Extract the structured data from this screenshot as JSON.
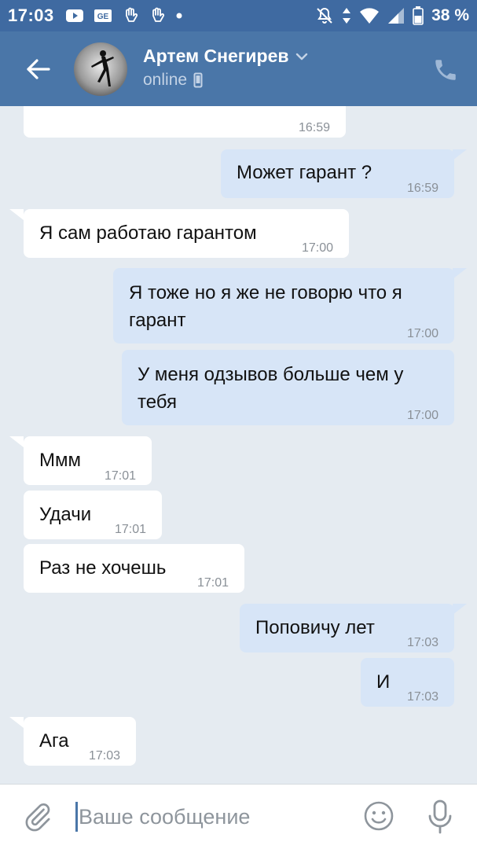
{
  "status_bar": {
    "time": "17:03",
    "battery": "38 %"
  },
  "header": {
    "contact_name": "Артем Снегирев",
    "status": "online"
  },
  "messages": [
    {
      "direction": "in",
      "text": "",
      "time": "16:59"
    },
    {
      "direction": "out",
      "text": "Может гарант ?",
      "time": "16:59"
    },
    {
      "direction": "in",
      "text": "Я сам работаю гарантом",
      "time": "17:00"
    },
    {
      "direction": "out",
      "line1": "Я тоже но я же не говорю что я",
      "line2": "гарант",
      "time": "17:00"
    },
    {
      "direction": "out",
      "line1": "У меня одзывов больше чем у",
      "line2": "тебя",
      "time": "17:00"
    },
    {
      "direction": "in",
      "text": "Ммм",
      "time": "17:01"
    },
    {
      "direction": "in",
      "text": "Удачи",
      "time": "17:01"
    },
    {
      "direction": "in",
      "text": "Раз не хочешь",
      "time": "17:01"
    },
    {
      "direction": "out",
      "text": "Поповичу лет",
      "time": "17:03"
    },
    {
      "direction": "out",
      "text": "И",
      "time": "17:03"
    },
    {
      "direction": "in",
      "text": "Ага",
      "time": "17:03"
    }
  ],
  "composer": {
    "placeholder": "Ваше сообщение",
    "value": ""
  },
  "colors": {
    "header": "#4a76a8",
    "status_bar": "#3f6aa1",
    "chat_background": "#e5ebf1",
    "outgoing_bubble": "#d7e5f7",
    "incoming_bubble": "#ffffff"
  },
  "icons": [
    "youtube-icon",
    "ge-icon",
    "hand-icon",
    "hand-icon",
    "dot-icon",
    "mute-icon",
    "data-arrows-icon",
    "wifi-icon",
    "signal-icon",
    "battery-icon",
    "back-arrow-icon",
    "chevron-down-icon",
    "phone-small-icon",
    "phone-call-icon",
    "paperclip-icon",
    "emoji-icon",
    "microphone-icon"
  ]
}
